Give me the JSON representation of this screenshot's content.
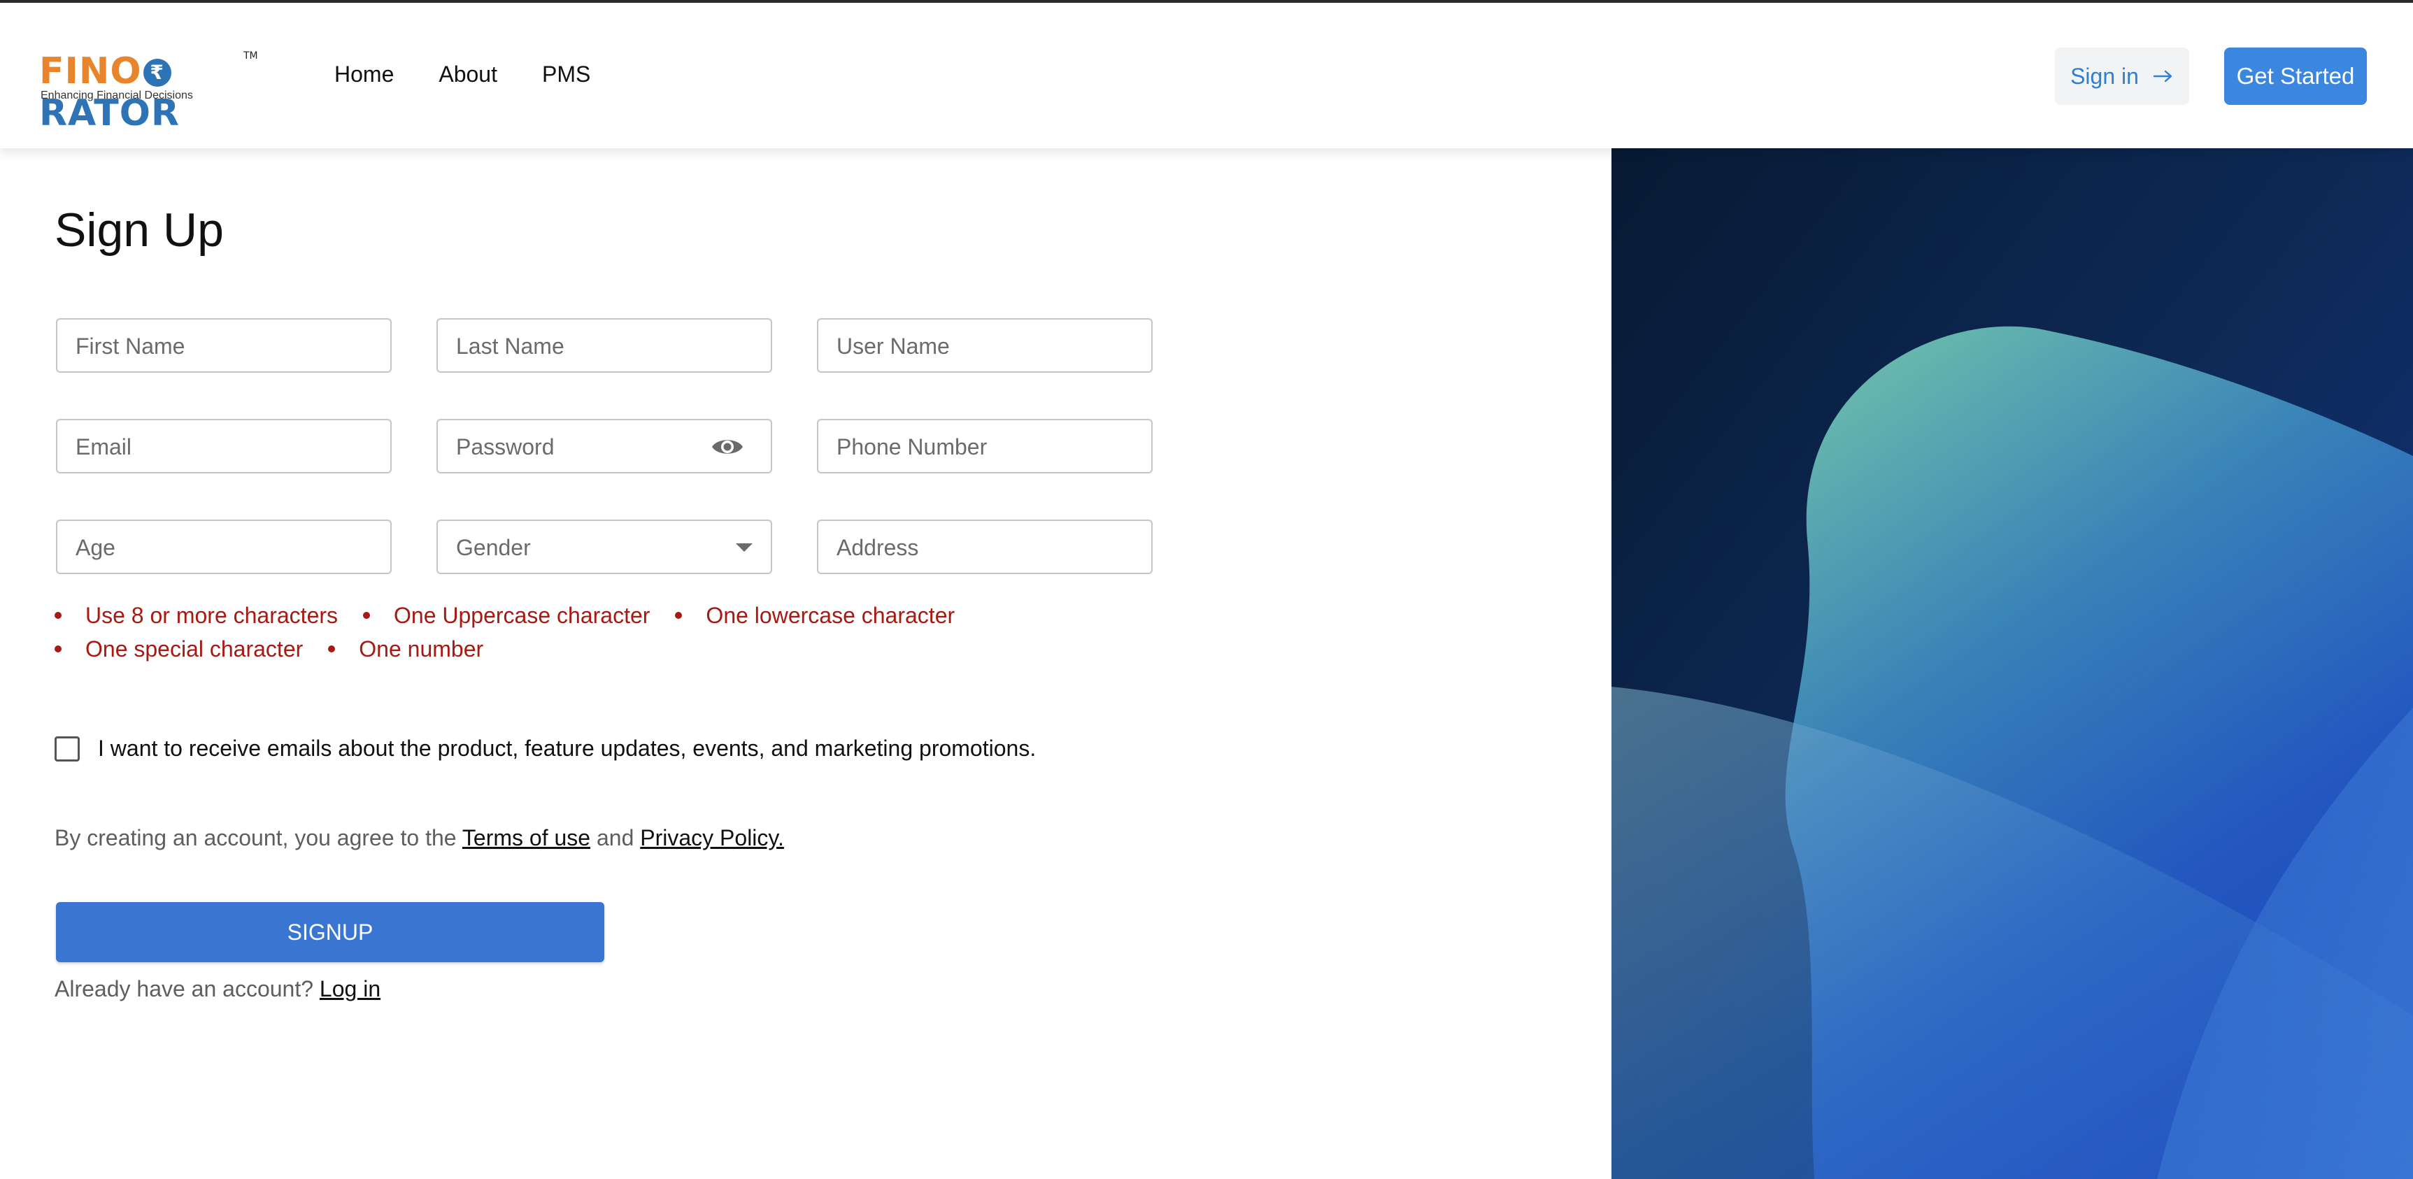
{
  "header": {
    "logo": {
      "brand_part1": "FINO",
      "brand_part2": "RATOR",
      "trademark": "TM",
      "tagline": "Enhancing Financial Decisions"
    },
    "nav": [
      {
        "label": "Home"
      },
      {
        "label": "About"
      },
      {
        "label": "PMS"
      }
    ],
    "signin_label": "Sign in",
    "get_started_label": "Get Started"
  },
  "form": {
    "title": "Sign Up",
    "fields": {
      "first_name": {
        "placeholder": "First Name"
      },
      "last_name": {
        "placeholder": "Last Name"
      },
      "user_name": {
        "placeholder": "User Name"
      },
      "email": {
        "placeholder": "Email"
      },
      "password": {
        "placeholder": "Password"
      },
      "phone": {
        "placeholder": "Phone Number"
      },
      "age": {
        "placeholder": "Age"
      },
      "gender": {
        "placeholder": "Gender"
      },
      "address": {
        "placeholder": "Address"
      }
    },
    "password_rules": [
      "Use 8 or more characters",
      "One Uppercase character",
      "One lowercase character",
      "One special character",
      "One number"
    ],
    "marketing_optin_label": "I want to receive emails about the product, feature updates, events, and marketing promotions.",
    "agree_prefix": "By creating an account, you agree to the ",
    "terms_link": "Terms of use",
    "agree_middle": " and ",
    "privacy_link": "Privacy Policy.",
    "signup_label": "SIGNUP",
    "login_prefix": "Already have an account? ",
    "login_link": "Log in"
  },
  "colors": {
    "primary": "#3a76d1",
    "error": "#a61a12",
    "logo_orange": "#e8842c",
    "logo_blue": "#2f73b7",
    "panel_dark": "#0b2140"
  }
}
